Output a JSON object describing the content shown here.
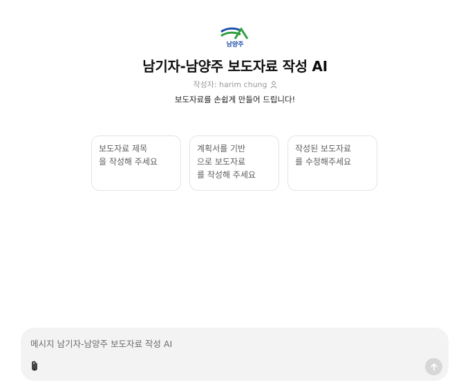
{
  "gpt": {
    "logo_text": "남양주",
    "title": "남기자-남양주 보도자료 작성 AI",
    "author": "작성자: harim chung",
    "description": "보도자료를 손쉽게 만들어 드립니다!"
  },
  "starters": [
    {
      "line1": "보도자료 제목",
      "line2": "을 작성해 주세요",
      "line3": ""
    },
    {
      "line1": "계획서를 기반",
      "line2": "으로 보도자료",
      "line3": "를 작성해 주세요"
    },
    {
      "line1": "작성된 보도자료",
      "line2": "를 수정해주세요",
      "line3": ""
    }
  ],
  "composer": {
    "placeholder": "메시지 남기자-남양주 보도자료 작성 AI"
  },
  "icons": {
    "author": "person-icon",
    "attach": "paperclip-icon",
    "send": "arrow-up-icon"
  },
  "colors": {
    "logo_blue": "#1f4fa8",
    "logo_green": "#2e9e3e",
    "send_disabled": "#d7d7d7"
  }
}
